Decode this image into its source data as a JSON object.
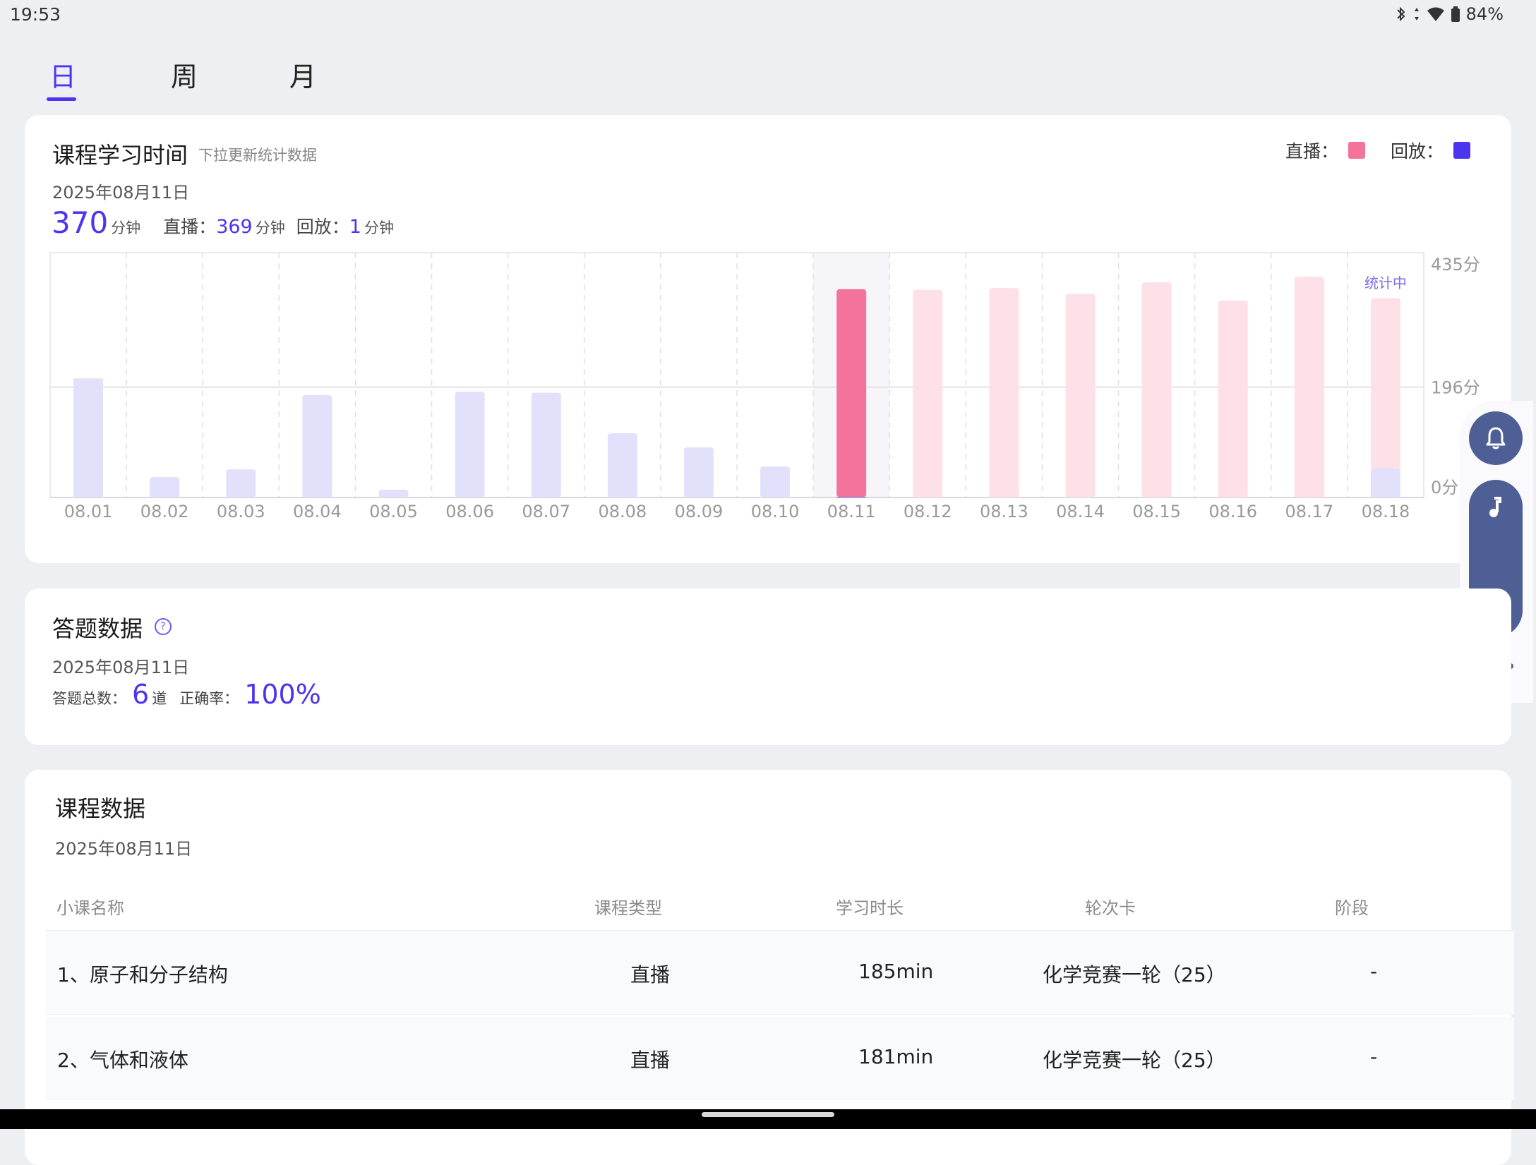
{
  "status": {
    "time": "19:53",
    "battery": "84%"
  },
  "tabs": [
    {
      "label": "日"
    },
    {
      "label": "周"
    },
    {
      "label": "月"
    }
  ],
  "study": {
    "title": "课程学习时间",
    "subtitle": "下拉更新统计数据",
    "date": "2025年08月11日",
    "total_value": "370",
    "unit": "分钟",
    "live_label": "直播：",
    "live_value": "369",
    "replay_label": "回放：",
    "replay_value": "1",
    "legend_live": "直播：",
    "legend_replay": "回放：",
    "colors": {
      "live": "#f3739a",
      "replay": "#4b35f0",
      "live_faded": "#fde0e8",
      "replay_faded": "#e3e0fb"
    }
  },
  "chart_data": {
    "type": "bar",
    "stacked": true,
    "categories": [
      "08.01",
      "08.02",
      "08.03",
      "08.04",
      "08.05",
      "08.06",
      "08.07",
      "08.08",
      "08.09",
      "08.10",
      "08.11",
      "08.12",
      "08.13",
      "08.14",
      "08.15",
      "08.16",
      "08.17",
      "08.18"
    ],
    "series": [
      {
        "name": "直播",
        "values": [
          2,
          0,
          0,
          0,
          0,
          0,
          0,
          0,
          0,
          0,
          369,
          369,
          372,
          362,
          382,
          350,
          392,
          302
        ]
      },
      {
        "name": "回放",
        "values": [
          210,
          36,
          50,
          182,
          14,
          188,
          186,
          114,
          89,
          55,
          1,
          0,
          0,
          0,
          0,
          0,
          0,
          52
        ]
      }
    ],
    "selected": "08.11",
    "annotation": "统计中",
    "y_ticks": [
      "435分",
      "196分",
      "0分"
    ],
    "ylim": [
      0,
      435
    ],
    "grid": true
  },
  "answer": {
    "title": "答题数据",
    "date": "2025年08月11日",
    "total_label": "答题总数：",
    "total_value": "6",
    "total_unit": "道",
    "accuracy_label": "正确率：",
    "accuracy_value": "100%"
  },
  "course": {
    "title": "课程数据",
    "date": "2025年08月11日",
    "headers": [
      "小课名称",
      "课程类型",
      "学习时长",
      "轮次卡",
      "阶段"
    ],
    "rows": [
      [
        "1、原子和分子结构",
        "直播",
        "185min",
        "化学竞赛一轮（25）",
        "-"
      ],
      [
        "2、气体和液体",
        "直播",
        "181min",
        "化学竞赛一轮（25）",
        "-"
      ]
    ]
  },
  "float": {
    "icons": [
      "bell-icon",
      "music-note-icon",
      "more-icon"
    ]
  }
}
